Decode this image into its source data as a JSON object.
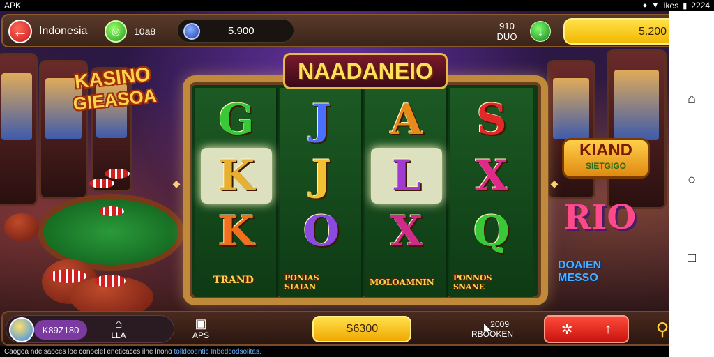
{
  "status_bar": {
    "app_label": "APK",
    "right_text": "Ikes",
    "time": "2224"
  },
  "top_bar": {
    "region": "Indonesia",
    "green_value": "10a8",
    "gem_value": "5.900",
    "small_info_line1": "910",
    "small_info_line2": "DUO",
    "balance": "5.200",
    "plus_label": "+"
  },
  "logo_left": {
    "line1": "KASINO",
    "line2": "GIEASOA"
  },
  "slot": {
    "title": "NAADANEIO",
    "reels": [
      {
        "symbols": [
          {
            "char": "G",
            "color": "#38c838"
          },
          {
            "char": "K",
            "color": "#e8b030",
            "highlight": true
          },
          {
            "char": "K",
            "color": "#f07020"
          }
        ]
      },
      {
        "symbols": [
          {
            "char": "J",
            "color": "#4a70ff"
          },
          {
            "char": "J",
            "color": "#f2c030"
          },
          {
            "char": "O",
            "color": "#8a4ae0"
          }
        ]
      },
      {
        "symbols": [
          {
            "char": "A",
            "color": "#e88a1a"
          },
          {
            "char": "L",
            "color": "#a03ad0",
            "highlight": true
          },
          {
            "char": "X",
            "color": "#d02a8a"
          }
        ]
      },
      {
        "symbols": [
          {
            "char": "S",
            "color": "#e02a2a"
          },
          {
            "char": "X",
            "color": "#e02a8a"
          },
          {
            "char": "Q",
            "color": "#38c838"
          }
        ]
      }
    ],
    "character_labels": [
      "TRAND",
      "PONIAS SIAIAN",
      "MOLOAMNIN",
      "PONNOS SNANE"
    ]
  },
  "logo_right": {
    "line1": "KIAND",
    "line2": "SIETGIGO"
  },
  "rio_text": "RIO",
  "bonus_text": {
    "line1": "DOAIEN",
    "line2": "MESSO"
  },
  "bottom_bar": {
    "profile_name": "K89Z180",
    "nav1_icon": "home-icon",
    "nav1_label": "LLA",
    "nav2_icon": "gift-icon",
    "nav2_label": "APS",
    "spin_label": "S6300",
    "extra_top": "2009",
    "extra_bottom": "RBOOKEN",
    "red_btn_icons": [
      "gear-icon",
      "arrow-up-icon"
    ],
    "search_icon": "search-icon"
  },
  "footer": {
    "text": "Caogoa ndeisaoces loe conoelel eneticaces ilne lnono",
    "link": "tolldcoentic Inbedcodsolitas."
  },
  "colors": {
    "accent_yellow": "#f2b800",
    "accent_red": "#c8140e",
    "frame_gold": "#c08a3a",
    "felt_green": "#0e5a1a"
  }
}
